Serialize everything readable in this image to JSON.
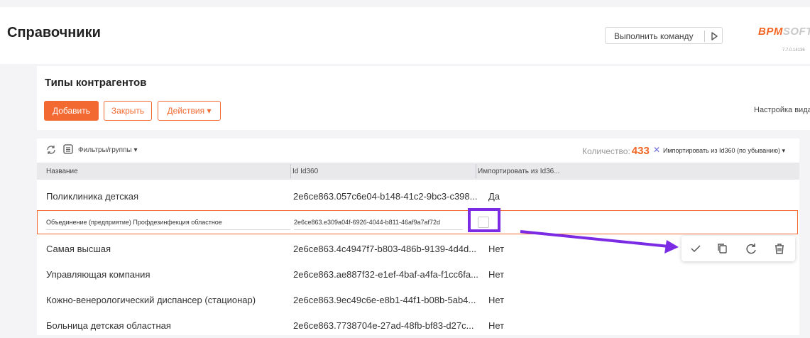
{
  "header": {
    "title": "Справочники",
    "command_label": "Выполнить команду",
    "logo_part1": "BPM",
    "logo_part2": "SOFT",
    "version": "7.7.0.14136"
  },
  "section": {
    "title": "Типы контрагентов",
    "add_label": "Добавить",
    "close_label": "Закрыть",
    "actions_label": "Действия ▾",
    "view_settings": "Настройка вида"
  },
  "filter": {
    "filters_label": "Фильтры/группы ▾",
    "count_label": "Количество:",
    "count_value": "433",
    "sort_remove": "✕",
    "sort_label": "Импортировать из Id360 (по убыванию) ▾"
  },
  "table": {
    "columns": [
      "Название",
      "Id Id360",
      "Импортировать из Id36..."
    ],
    "rows": [
      {
        "name": "Поликлиника детская",
        "id": "2e6ce863.057c6e04-b148-41c2-9bc3-c398...",
        "imported": "Да"
      },
      {
        "name": "Объединение (предприятие) Профдезинфекция областное",
        "id": "2e6ce863.e309a04f-6926-4044-b811-46af9a7af72d",
        "imported": ""
      },
      {
        "name": "Самая высшая",
        "id": "2e6ce863.4c4947f7-b803-486b-9139-4d4d...",
        "imported": "Нет"
      },
      {
        "name": "Управляющая компания",
        "id": "2e6ce863.ae887f32-e1ef-4baf-a4fa-f1cc6fa...",
        "imported": "Нет"
      },
      {
        "name": "Кожно-венерологический диспансер (стационар)",
        "id": "2e6ce863.9ec49c6e-e8b1-44f1-b08b-5ab4...",
        "imported": "Нет"
      },
      {
        "name": "Больница детская областная",
        "id": "2e6ce863.7738704e-27ad-48fb-bf83-d27c...",
        "imported": "Нет"
      }
    ]
  },
  "row_actions": {
    "icons": [
      "check-icon",
      "copy-icon",
      "undo-icon",
      "delete-icon"
    ]
  },
  "colors": {
    "accent": "#f26a32",
    "annotation": "#7b2be3"
  }
}
